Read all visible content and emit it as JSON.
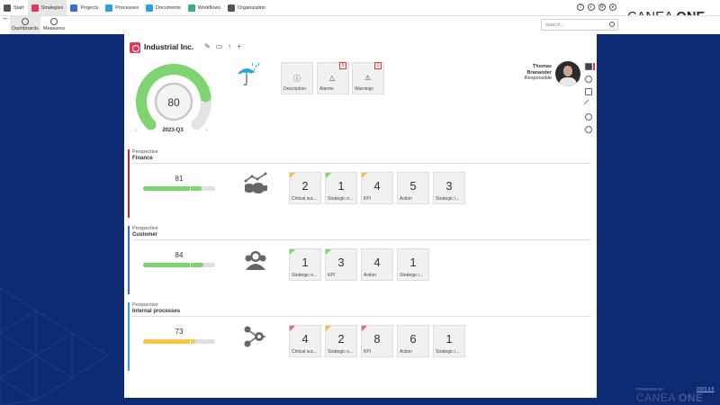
{
  "nav": {
    "items": [
      {
        "label": "Start",
        "color": "#555555"
      },
      {
        "label": "Strategies",
        "color": "#e2365f"
      },
      {
        "label": "Projects",
        "color": "#3a6ad8"
      },
      {
        "label": "Processes",
        "color": "#2ba3d6"
      },
      {
        "label": "Documents",
        "color": "#2ba3d6"
      },
      {
        "label": "Workflows",
        "color": "#3bb07a"
      },
      {
        "label": "Organization",
        "color": "#555555"
      }
    ],
    "subtabs": [
      {
        "label": "Dashboards"
      },
      {
        "label": "Measures"
      }
    ]
  },
  "search": {
    "placeholder": "search..."
  },
  "brand": {
    "text": "CANEA",
    "bold": "ONE"
  },
  "org": {
    "title": "Industrial Inc."
  },
  "gauge": {
    "value": "80",
    "period": "2023-Q3",
    "fraction": 0.8,
    "color": "#7ed46e"
  },
  "info_tiles": [
    {
      "label": "Description",
      "badge": ""
    },
    {
      "label": "Alarms",
      "badge": "5"
    },
    {
      "label": "Warnings",
      "badge": "1"
    }
  ],
  "responsible": {
    "first": "Thomas",
    "last": "Branander",
    "role": "Responsible"
  },
  "perspectives": [
    {
      "sub": "Perspective",
      "name": "Finance",
      "score": "81",
      "fraction": 0.81,
      "bar_color": "#b0284a",
      "fill_color": "#7ed46e",
      "tiles": [
        {
          "num": "2",
          "label": "Critical suc...",
          "corner": "#f0c040"
        },
        {
          "num": "1",
          "label": "Strategic o...",
          "corner": "#7ed46e"
        },
        {
          "num": "4",
          "label": "KPI",
          "corner": "#f0c040"
        },
        {
          "num": "5",
          "label": "Action",
          "corner": ""
        },
        {
          "num": "3",
          "label": "Strategic i...",
          "corner": ""
        }
      ]
    },
    {
      "sub": "Perspective",
      "name": "Customer",
      "score": "84",
      "fraction": 0.84,
      "bar_color": "#3a6ad8",
      "fill_color": "#7ed46e",
      "tiles": [
        {
          "num": "1",
          "label": "Strategic o...",
          "corner": "#7ed46e"
        },
        {
          "num": "3",
          "label": "KPI",
          "corner": "#7ed46e"
        },
        {
          "num": "4",
          "label": "Action",
          "corner": ""
        },
        {
          "num": "1",
          "label": "Strategic i...",
          "corner": ""
        }
      ]
    },
    {
      "sub": "Perspective",
      "name": "Internal processes",
      "score": "73",
      "fraction": 0.73,
      "bar_color": "#2ba3d6",
      "fill_color": "#f5c842",
      "tiles": [
        {
          "num": "4",
          "label": "Critical suc...",
          "corner": "#f06060"
        },
        {
          "num": "2",
          "label": "Strategic o...",
          "corner": "#f0c040"
        },
        {
          "num": "8",
          "label": "KPI",
          "corner": "#f06060"
        },
        {
          "num": "6",
          "label": "Action",
          "corner": ""
        },
        {
          "num": "1",
          "label": "Strategic i...",
          "corner": ""
        }
      ]
    }
  ],
  "footer": {
    "powered": "POWERED BY",
    "brand": "CANEA",
    "brand_bold": "ONE",
    "version": "2023.3.5"
  }
}
